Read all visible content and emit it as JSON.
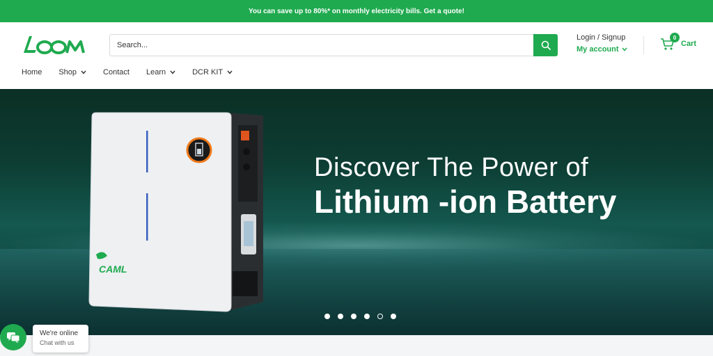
{
  "announcement": {
    "text": "You can save up to 80%* on monthly electricity bills. Get a quote!"
  },
  "brand": {
    "logo_text": "LOOM",
    "color": "#1faa4f"
  },
  "search": {
    "placeholder": "Search..."
  },
  "account": {
    "login_label": "Login / Signup",
    "my_account_label": "My account"
  },
  "cart": {
    "count": "0",
    "label": "Cart"
  },
  "nav": {
    "items": [
      {
        "label": "Home",
        "has_dropdown": false
      },
      {
        "label": "Shop",
        "has_dropdown": true
      },
      {
        "label": "Contact",
        "has_dropdown": false
      },
      {
        "label": "Learn",
        "has_dropdown": true
      },
      {
        "label": "DCR KIT",
        "has_dropdown": true
      }
    ]
  },
  "hero": {
    "line1": "Discover The Power of",
    "line2": "Lithium -ion Battery",
    "product_brand": "CAML",
    "slides": 6,
    "active_slide": 5
  },
  "chat": {
    "title": "We're online",
    "subtitle": "Chat with us"
  }
}
